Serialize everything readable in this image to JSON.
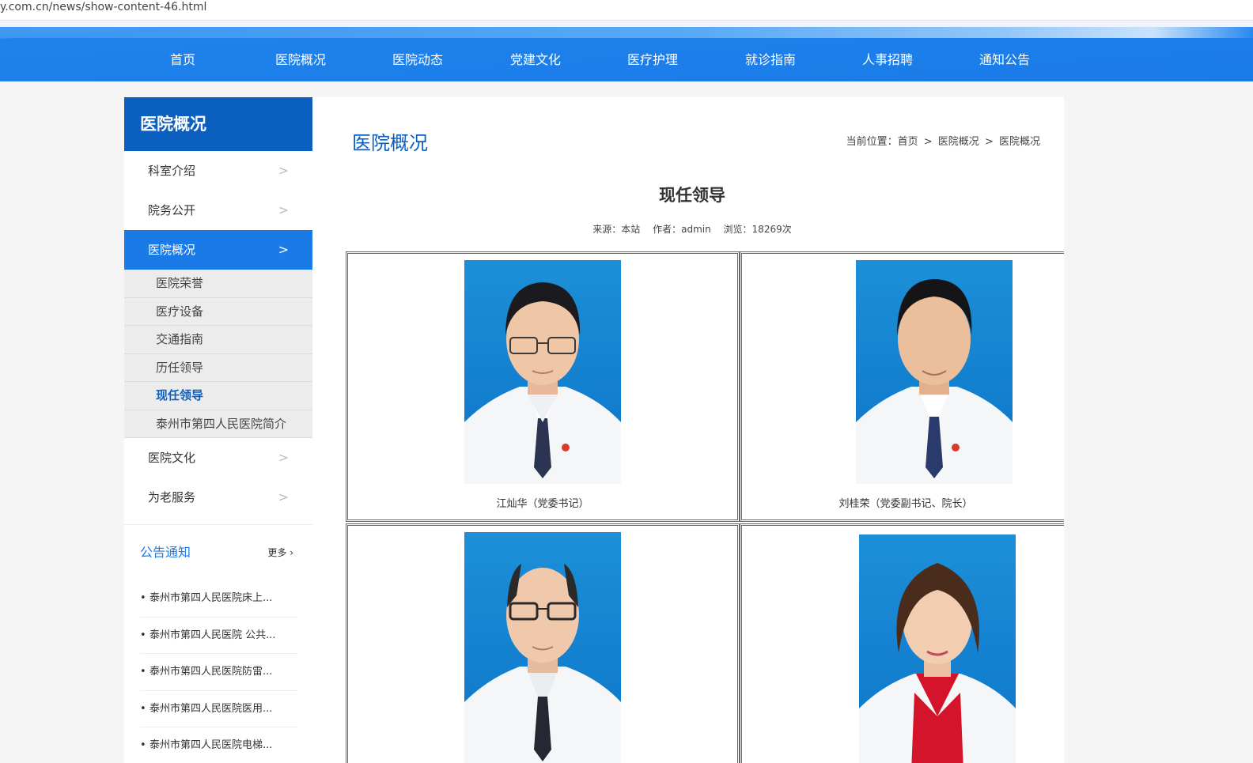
{
  "browser": {
    "url": "y.com.cn/news/show-content-46.html"
  },
  "nav": {
    "items": [
      "首页",
      "医院概况",
      "医院动态",
      "党建文化",
      "医疗护理",
      "就诊指南",
      "人事招聘",
      "通知公告"
    ]
  },
  "sidebar": {
    "heading": "医院概况",
    "items": [
      {
        "label": "科室介绍",
        "chevron": ">"
      },
      {
        "label": "院务公开",
        "chevron": ">"
      },
      {
        "label": "医院概况",
        "chevron": ">"
      }
    ],
    "sub_items": [
      "医院荣誉",
      "医疗设备",
      "交通指南",
      "历任领导",
      "现任领导",
      "泰州市第四人民医院简介"
    ],
    "items_after": [
      {
        "label": "医院文化",
        "chevron": ">"
      },
      {
        "label": "为老服务",
        "chevron": ">"
      }
    ],
    "notice": {
      "title": "公告通知",
      "more": "更多",
      "more_icon": "›",
      "bullet": "•",
      "items": [
        "泰州市第四人民医院床上...",
        "泰州市第四人民医院 公共...",
        "泰州市第四人民医院防雷...",
        "泰州市第四人民医院医用...",
        "泰州市第四人民医院电梯..."
      ]
    }
  },
  "main": {
    "title": "医院概况",
    "breadcrumb": {
      "prefix": "当前位置：",
      "items": [
        "首页",
        "医院概况",
        "医院概况"
      ],
      "separator": ">"
    },
    "article": {
      "title": "现任领导",
      "source": "来源：本站",
      "author": "作者：admin",
      "views": "浏览：18269次"
    },
    "leaders": [
      {
        "caption": "江灿华（党委书记）"
      },
      {
        "caption": "刘桂荣（党委副书记、院长）"
      },
      {
        "caption": ""
      },
      {
        "caption": ""
      }
    ]
  },
  "colors": {
    "nav_blue": "#1a7be8",
    "heading_blue": "#0a5fbf",
    "photo_bg": "#137fcf"
  }
}
